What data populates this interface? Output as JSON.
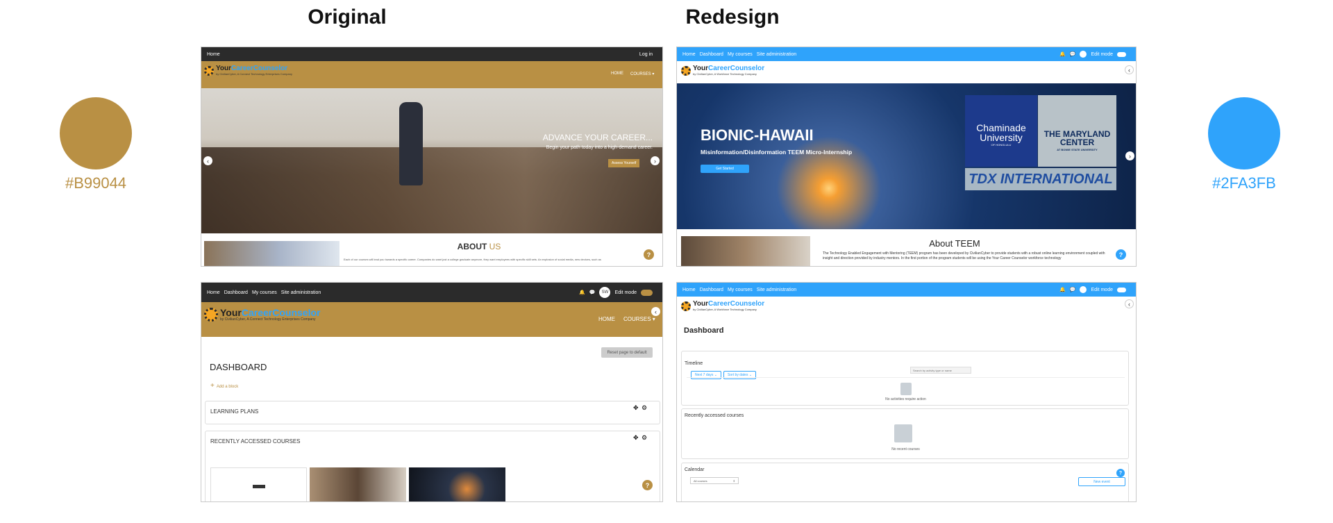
{
  "headings": {
    "original": "Original",
    "redesign": "Redesign"
  },
  "colors": {
    "original_hex": "#B99044",
    "redesign_hex": "#2FA3FB",
    "dark": "#2b2b2b"
  },
  "orig_home": {
    "nav_left": "Home",
    "nav_right": "Log in",
    "logo_main_a": "Your",
    "logo_main_b": "CareerCounselor",
    "logo_sub": "by CivilianCyber, A Connect Technology Enterprises Company",
    "menu_home": "HOME",
    "menu_courses": "COURSES ▾",
    "hero_title": "ADVANCE YOUR CAREER...",
    "hero_sub": "Begin your path today into a high-demand career.",
    "hero_btn": "Assess Yourself",
    "about_a": "ABOUT",
    "about_b": "US",
    "about_text": "Each of our courses will lead you towards a specific career. Companies do want just a college graduate anymore, they want employees with specific skill sets. An explosion of social media, new devices, such as"
  },
  "orig_dash": {
    "nav": [
      "Home",
      "Dashboard",
      "My courses",
      "Site administration"
    ],
    "avatar": "SW",
    "edit_mode": "Edit mode",
    "logo_main_a": "Your",
    "logo_main_b": "CareerCounselor",
    "logo_sub": "by CivilianCyber, A Connect Technology Enterprises Company",
    "menu_home": "HOME",
    "menu_courses": "COURSES ▾",
    "reset_btn": "Reset page to default",
    "title": "DASHBOARD",
    "add_block": "Add a block",
    "block1": "LEARNING PLANS",
    "block2": "RECENTLY ACCESSED COURSES"
  },
  "red_home": {
    "nav": [
      "Home",
      "Dashboard",
      "My courses",
      "Site administration"
    ],
    "edit_mode": "Edit mode",
    "logo_main_a": "Your",
    "logo_main_b": "CareerCounselor",
    "logo_sub": "by CivilianCyber, A Workforce Technology Company",
    "hero_title": "BIONIC-HAWAII",
    "hero_sub": "Misinformation/Disinformation TEEM Micro-Internship",
    "hero_btn": "Get Started",
    "logo_chaminade": "Chaminade University",
    "logo_chaminade_sub": "OF HONOLULU",
    "logo_maryland": "THE MARYLAND CENTER",
    "logo_maryland_sub": "AT BOWIE STATE UNIVERSITY",
    "logo_tdx": "TDX INTERNATIONAL",
    "about_title": "About TEEM",
    "about_text": "The Technology Enabled Engagement with Mentoring (TEEM) program has been developed by CivilianCyber to provide students with a robust online learning environment coupled with insight and direction provided by industry mentors. In the first portion of the program students will be using the Your Career Counselor workforce technology"
  },
  "red_dash": {
    "nav": [
      "Home",
      "Dashboard",
      "My courses",
      "Site administration"
    ],
    "edit_mode": "Edit mode",
    "logo_main_a": "Your",
    "logo_main_b": "CareerCounselor",
    "logo_sub": "by CivilianCyber, A Workforce Technology Company",
    "title": "Dashboard",
    "timeline": "Timeline",
    "filter1": "Next 7 days ⌄",
    "filter2": "Sort by dates ⌄",
    "search_placeholder": "Search by activity type or name",
    "no_activities": "No activities require action",
    "recent": "Recently accessed courses",
    "no_recent": "No recent courses",
    "calendar": "Calendar",
    "all_courses": "All courses",
    "new_event": "New event"
  }
}
